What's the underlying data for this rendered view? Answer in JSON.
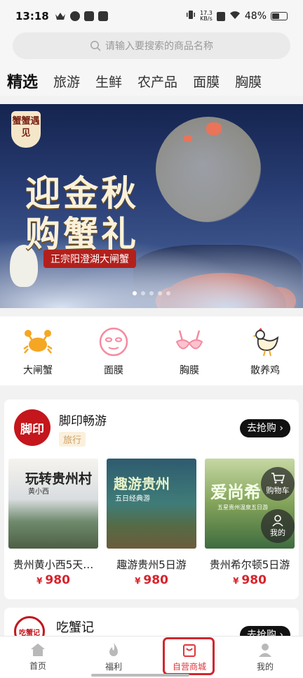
{
  "status_bar": {
    "time": "13:18",
    "net_speed_top": "17.3",
    "net_speed_unit": "KB/s",
    "battery": "48%"
  },
  "search": {
    "placeholder": "请输入要搜索的商品名称"
  },
  "tabs": [
    {
      "label": "精选",
      "active": true
    },
    {
      "label": "旅游"
    },
    {
      "label": "生鲜"
    },
    {
      "label": "农产品"
    },
    {
      "label": "面膜"
    },
    {
      "label": "胸膜"
    }
  ],
  "banner": {
    "tag": "蟹蟹遇见",
    "title_line1": "迎金秋",
    "title_line2": "购蟹礼",
    "ribbon": "正宗阳澄湖大闸蟹"
  },
  "categories": [
    {
      "label": "大闸蟹",
      "icon": "crab-icon"
    },
    {
      "label": "面膜",
      "icon": "face-mask-icon"
    },
    {
      "label": "胸膜",
      "icon": "bra-icon"
    },
    {
      "label": "散养鸡",
      "icon": "chicken-icon"
    }
  ],
  "shop1": {
    "logo_text": "脚印",
    "name": "脚印畅游",
    "tag": "旅行",
    "button": "去抢购",
    "products": [
      {
        "name": "贵州黄小西5天…",
        "price": "980",
        "currency": "¥",
        "img_text": "玩转贵州村",
        "img_sub": "黄小西"
      },
      {
        "name": "趣游贵州5日游",
        "price": "980",
        "currency": "¥",
        "img_text": "趣游贵州",
        "img_sub": "五日经典游"
      },
      {
        "name": "贵州希尔顿5日游",
        "price": "980",
        "currency": "¥",
        "img_text": "爱尚希",
        "img_sub": "五星贵州温泉五日游"
      }
    ]
  },
  "shop2": {
    "logo_text": "吃蟹记",
    "name": "吃蟹记",
    "button": "去抢购"
  },
  "float": {
    "cart": "购物车",
    "mine": "我的"
  },
  "tabbar": [
    {
      "label": "首页",
      "icon": "home-icon"
    },
    {
      "label": "福利",
      "icon": "flame-icon"
    },
    {
      "label": "自营商城",
      "icon": "shopping-bag-icon",
      "active": true
    },
    {
      "label": "我的",
      "icon": "user-icon"
    }
  ],
  "colors": {
    "accent": "#e3353a",
    "price": "#d6232b",
    "button": "#111111"
  }
}
